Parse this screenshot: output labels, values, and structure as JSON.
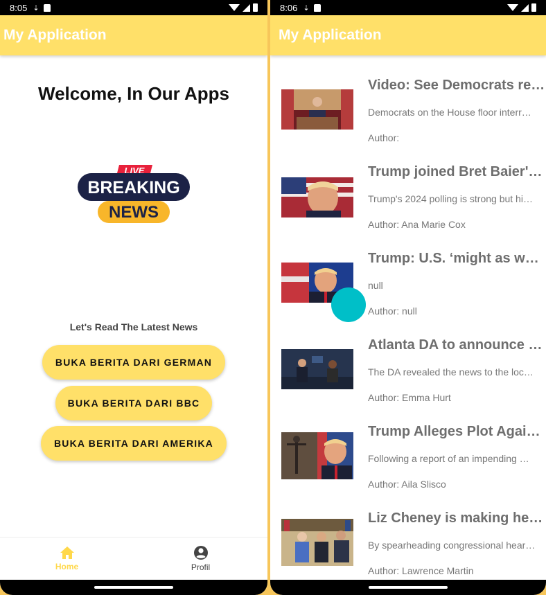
{
  "left_screen": {
    "status": {
      "time": "8:05"
    },
    "app_title": "My Application",
    "welcome": "Welcome, In Our Apps",
    "logo": {
      "live": "LIVE",
      "breaking": "BREAKING",
      "news": "NEWS"
    },
    "subtitle": "Let's Read The Latest News",
    "buttons": [
      "BUKA BERITA DARI GERMAN",
      "BUKA BERITA DARI BBC",
      "BUKA BERITA DARI AMERIKA"
    ],
    "bottom_nav": [
      {
        "label": "Home",
        "icon": "home-icon",
        "active": true
      },
      {
        "label": "Profil",
        "icon": "account-circle-icon",
        "active": false
      }
    ]
  },
  "right_screen": {
    "status": {
      "time": "8:06"
    },
    "app_title": "My Application",
    "news": [
      {
        "title": "Video: See Democrats rep…",
        "description": "Democrats on the House floor interr…",
        "author": "Author:"
      },
      {
        "title": "Trump joined Bret Baier's …",
        "description": "Trump's 2024 polling is strong but hi…",
        "author": "Author: Ana Marie Cox"
      },
      {
        "title": "Trump: U.S. ‘might as wel…",
        "description": "null",
        "author": "Author: null"
      },
      {
        "title": "Atlanta DA to announce c…",
        "description": "The DA revealed the news to the loc…",
        "author": "Author: Emma Hurt"
      },
      {
        "title": "Trump Alleges Plot Again…",
        "description": "Following a report of an impending …",
        "author": "Author: Aila Slisco"
      },
      {
        "title": "Liz Cheney is making hea…",
        "description": "By spearheading congressional hear…",
        "author": "Author: Lawrence Martin"
      }
    ]
  },
  "colors": {
    "appbar": "#ffe069",
    "accent": "#ffd84a",
    "touch_indicator": "#00bfc8",
    "frame": "#f7c65a"
  }
}
